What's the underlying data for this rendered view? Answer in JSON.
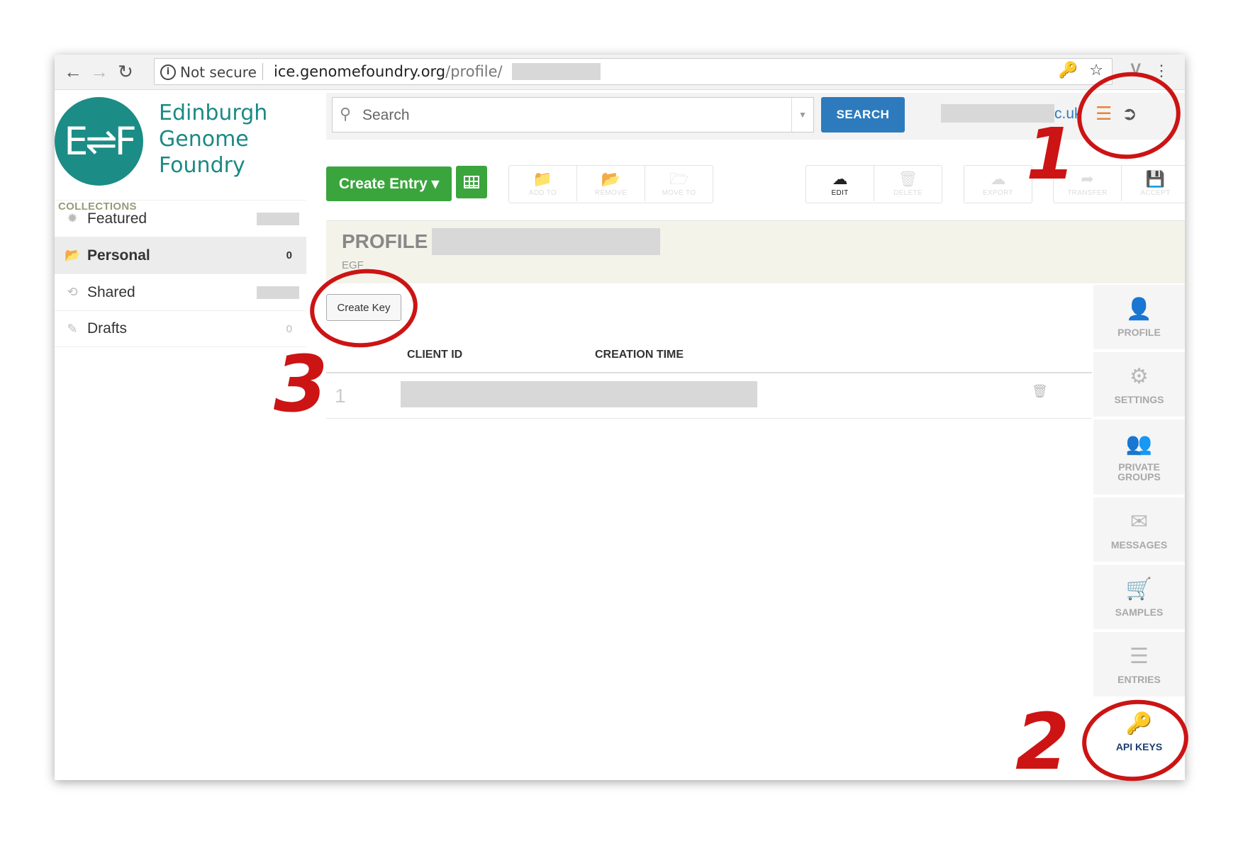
{
  "browser": {
    "security_label": "Not secure",
    "url_host": "ice.genomefoundry.org",
    "url_path": "/profile/"
  },
  "logo": {
    "initials": "E⇌F",
    "lines": [
      "Edinburgh",
      "Genome",
      "Foundry"
    ]
  },
  "sidebar": {
    "section_label": "COLLECTIONS",
    "items": [
      {
        "label": "Featured",
        "count": ""
      },
      {
        "label": "Personal",
        "count": "0"
      },
      {
        "label": "Shared",
        "count": ""
      },
      {
        "label": "Drafts",
        "count": "0"
      }
    ]
  },
  "topbar": {
    "search_placeholder": "Search",
    "search_button": "SEARCH",
    "user_suffix": "c.uk"
  },
  "toolbar": {
    "create_entry": "Create Entry",
    "actions_a": [
      "ADD TO",
      "REMOVE",
      "MOVE TO"
    ],
    "actions_b": [
      "EDIT",
      "DELETE"
    ],
    "actions_c": [
      "EXPORT"
    ],
    "actions_d": [
      "TRANSFER",
      "ACCEPT"
    ]
  },
  "profile": {
    "title": "PROFILE",
    "subtitle": "EGF"
  },
  "keys": {
    "create_key": "Create Key",
    "columns": [
      "CLIENT ID",
      "CREATION TIME"
    ],
    "rows": [
      {
        "index": "1"
      }
    ]
  },
  "right_nav": [
    {
      "label": "PROFILE",
      "icon": "user-icon"
    },
    {
      "label": "SETTINGS",
      "icon": "gear-icon"
    },
    {
      "label": "PRIVATE GROUPS",
      "icon": "group-icon"
    },
    {
      "label": "MESSAGES",
      "icon": "envelope-icon"
    },
    {
      "label": "SAMPLES",
      "icon": "cart-icon"
    },
    {
      "label": "ENTRIES",
      "icon": "list-icon"
    },
    {
      "label": "API KEYS",
      "icon": "key-icon"
    }
  ],
  "annotations": [
    "1",
    "2",
    "3"
  ],
  "colors": {
    "brand_teal": "#1c8c86",
    "search_blue": "#2d7bbd",
    "create_green": "#3aa53d",
    "annotation_red": "#cc1414",
    "active_nav": "#1c3e6e"
  }
}
